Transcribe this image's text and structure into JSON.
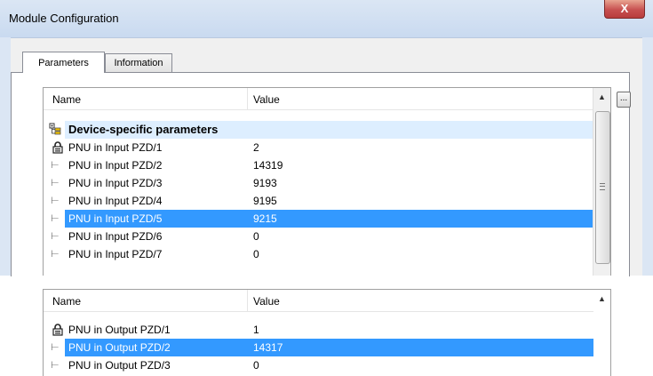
{
  "window": {
    "title": "Module Configuration",
    "close_glyph": "X"
  },
  "tabs": [
    {
      "label": "Parameters",
      "active": true
    },
    {
      "label": "Information",
      "active": false
    }
  ],
  "browse_label": "...",
  "list_top": {
    "header": {
      "name": "Name",
      "value": "Value"
    },
    "group": {
      "label": "Device-specific parameters",
      "icon": "tree-group-icon"
    },
    "rows": [
      {
        "name": "PNU in Input PZD/1",
        "value": "2",
        "icon": "lock-icon"
      },
      {
        "name": "PNU in Input PZD/2",
        "value": "14319",
        "icon": "arrow-icon"
      },
      {
        "name": "PNU in Input PZD/3",
        "value": "9193",
        "icon": "arrow-icon"
      },
      {
        "name": "PNU in Input PZD/4",
        "value": "9195",
        "icon": "arrow-icon"
      },
      {
        "name": "PNU in Input PZD/5",
        "value": "9215",
        "icon": "arrow-icon",
        "selected": true
      },
      {
        "name": "PNU in Input PZD/6",
        "value": "0",
        "icon": "arrow-icon"
      },
      {
        "name": "PNU in Input PZD/7",
        "value": "0",
        "icon": "arrow-icon"
      }
    ]
  },
  "list_bottom": {
    "header": {
      "name": "Name",
      "value": "Value"
    },
    "rows": [
      {
        "name": "PNU in Output PZD/1",
        "value": "1",
        "icon": "lock-icon"
      },
      {
        "name": "PNU in Output PZD/2",
        "value": "14317",
        "icon": "arrow-icon",
        "selected": true
      },
      {
        "name": "PNU in Output PZD/3",
        "value": "0",
        "icon": "arrow-icon"
      }
    ]
  },
  "colors": {
    "selection": "#3399ff",
    "group_bg": "#ddeeff",
    "titlebar": "#dbe6f4",
    "close": "#c75050"
  }
}
